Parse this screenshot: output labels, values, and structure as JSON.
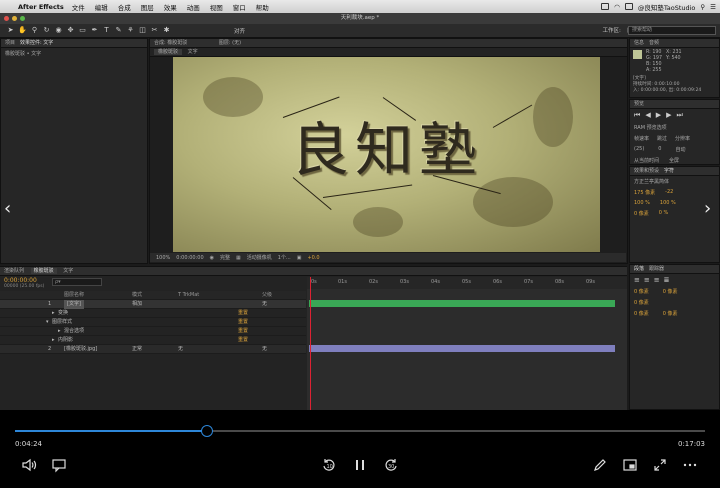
{
  "menubar": {
    "app_name": "After Effects",
    "items": [
      "文件",
      "编辑",
      "合成",
      "图层",
      "效果",
      "动画",
      "视图",
      "窗口",
      "帮助"
    ],
    "tray_text": "@良知塾TaoStudio"
  },
  "window": {
    "title": "天利裁块.aep *"
  },
  "toolbar": {
    "align_label": "对齐",
    "workspace_label": "工作区:",
    "workspace_value": "良知塾TaoStudio",
    "search_placeholder": "搜索帮助"
  },
  "left_panel": {
    "tab": "项目",
    "effects_tab": "效果控件: 文字",
    "breadcrumb": "橡胶斑驳 • 文字"
  },
  "comp_panel": {
    "tab": "合成: 橡胶斑驳",
    "layer_tab": "图层: (无)",
    "sub_tabs": [
      "橡胶斑驳",
      "文字"
    ],
    "artwork_text": "良知塾",
    "zoom": "100%",
    "timecode": "0:00:00:00",
    "quality": "完整",
    "camera": "活动摄像机",
    "views": "1个...",
    "exposure": "+0.0"
  },
  "info_panel": {
    "tabs": [
      "信息",
      "音频"
    ],
    "r": "R: 190",
    "g": "G: 197",
    "b": "B: 150",
    "a": "A: 255",
    "x": "X: 231",
    "y": "Y: 540",
    "layer_label": "[文字]",
    "duration": "持续时间: 0:00:10:00",
    "in_out": "入: 0:00:00:00, 出: 0:00:09:24"
  },
  "preview_panel": {
    "tab": "预览",
    "ram_label": "RAM 预览选项",
    "fps_label": "帧速率",
    "skip_label": "跳过",
    "res_label": "分辨率",
    "fps_value": "(25)",
    "skip_value": "0",
    "res_value": "自动",
    "from_current": "从当前时间",
    "fullscreen": "全屏"
  },
  "char_panel": {
    "tabs": [
      "效果和预设",
      "字符"
    ],
    "font": "方正兰亭黑简体",
    "size": "175 像素",
    "tracking": "-22",
    "scale_v": "100 %",
    "scale_h": "100 %",
    "baseline": "0 像素",
    "tsume": "0 %"
  },
  "para_panel": {
    "tabs": [
      "段落",
      "跟踪器"
    ],
    "indent1": "0 像素",
    "indent2": "0 像素",
    "indent3": "0 像素",
    "space1": "0 像素",
    "space2": "0 像素"
  },
  "timeline": {
    "tabs": [
      "渲染队列",
      "橡胶斑驳",
      "文字"
    ],
    "timecode": "0:00:00:00",
    "fps": "00000 (25.00 fps)",
    "search_placeholder": "ρ▾",
    "columns": {
      "name": "图层名称",
      "mode": "模式",
      "trkmat": "T  TrkMat",
      "parent": "父级"
    },
    "layers": [
      {
        "num": "1",
        "name": "[文字]",
        "mode": "相加",
        "parent": "无"
      },
      {
        "num": "",
        "name": "变换",
        "reset": "重置"
      },
      {
        "num": "",
        "name": "图层样式",
        "reset": "重置"
      },
      {
        "num": "",
        "name": "混合选项",
        "reset": "重置"
      },
      {
        "num": "",
        "name": "内阴影",
        "reset": "重置"
      },
      {
        "num": "2",
        "name": "[橡胶斑驳.jpg]",
        "mode": "正常",
        "trkmat": "无",
        "parent": "无"
      }
    ],
    "ruler_labels": [
      "0s",
      "01s",
      "02s",
      "03s",
      "04s",
      "05s",
      "06s",
      "07s",
      "08s",
      "09s"
    ]
  },
  "player": {
    "current_time": "0:04:24",
    "total_time": "0:17:03",
    "progress": 0.278
  },
  "colors": {
    "accent": "#2d86d8",
    "timeline_yellow": "#d9a23a",
    "green_bar": "#3aa856",
    "purple_bar": "#7f7fbe"
  }
}
